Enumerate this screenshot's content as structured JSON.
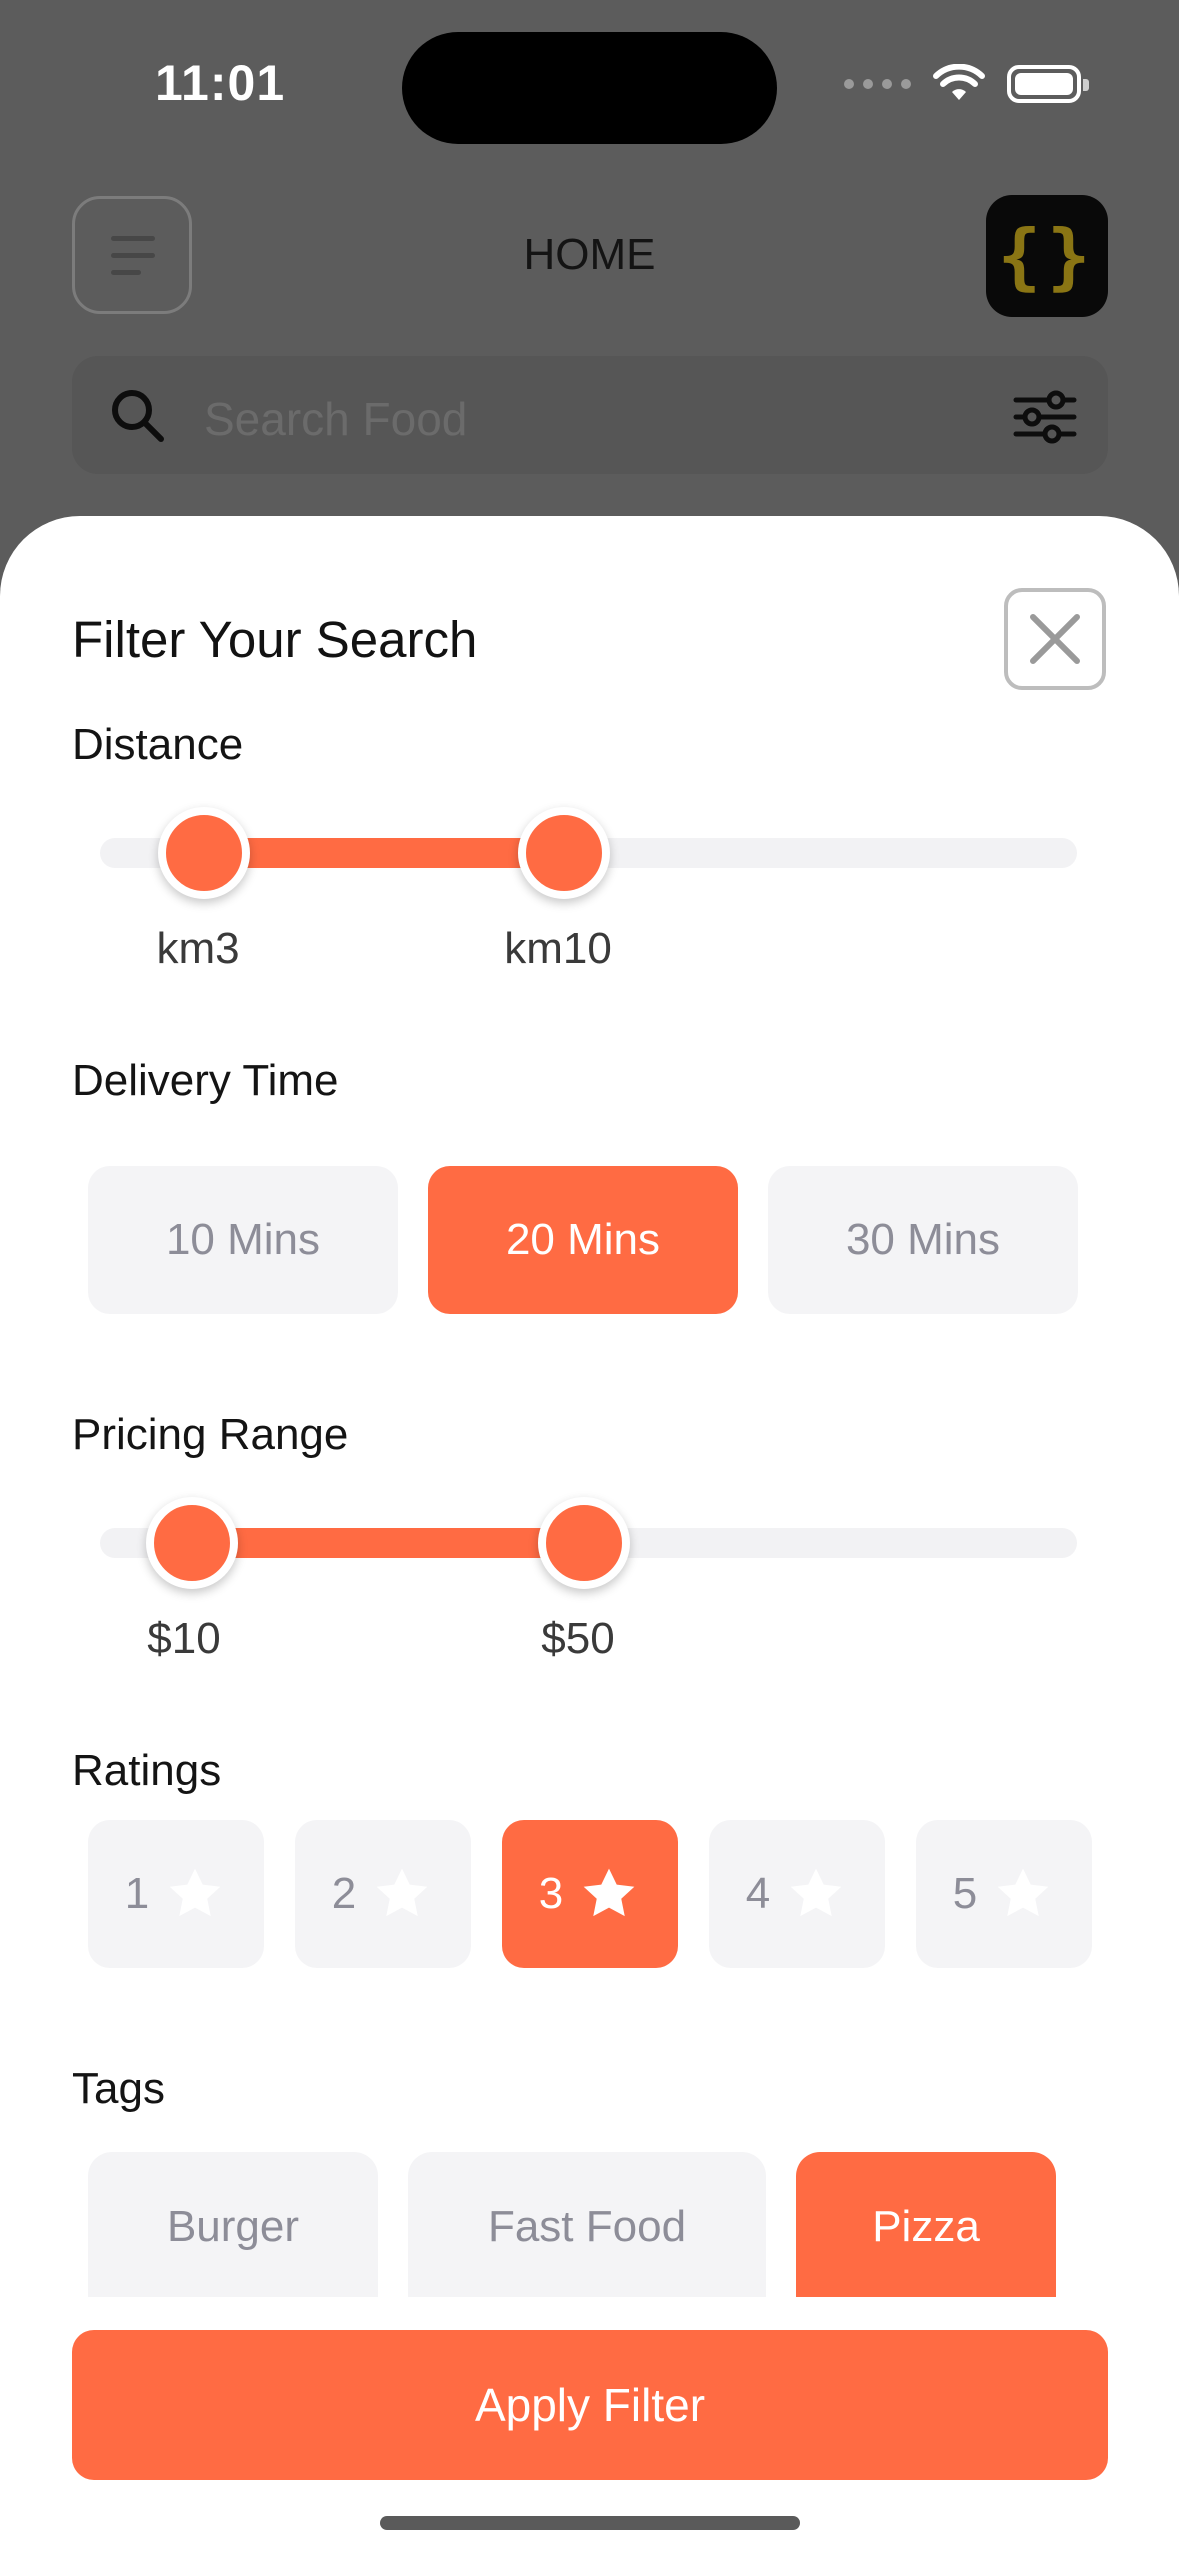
{
  "status_bar": {
    "time": "11:01"
  },
  "header": {
    "title": "HOME",
    "logo_text": "{}"
  },
  "search": {
    "placeholder": "Search Food"
  },
  "filter_sheet": {
    "title": "Filter Your Search",
    "distance": {
      "label": "Distance",
      "min_label": "km3",
      "max_label": "km10"
    },
    "delivery_time": {
      "label": "Delivery Time",
      "options": [
        "10 Mins",
        "20 Mins",
        "30 Mins"
      ],
      "selected": "20 Mins"
    },
    "pricing": {
      "label": "Pricing Range",
      "min_label": "$10",
      "max_label": "$50"
    },
    "ratings": {
      "label": "Ratings",
      "options": [
        "1",
        "2",
        "3",
        "4",
        "5"
      ],
      "selected": "3"
    },
    "tags": {
      "label": "Tags",
      "options": [
        "Burger",
        "Fast Food",
        "Pizza"
      ],
      "selected": "Pizza"
    },
    "apply_label": "Apply Filter"
  },
  "colors": {
    "accent": "#ff6b43",
    "chip_bg": "#f4f4f6",
    "chip_text": "#8d8d98",
    "overlay": "#5c5c5c"
  },
  "icons": [
    "menu-icon",
    "search-icon",
    "filter-sliders-icon",
    "close-icon",
    "star-icon",
    "wifi-icon",
    "battery-icon"
  ]
}
